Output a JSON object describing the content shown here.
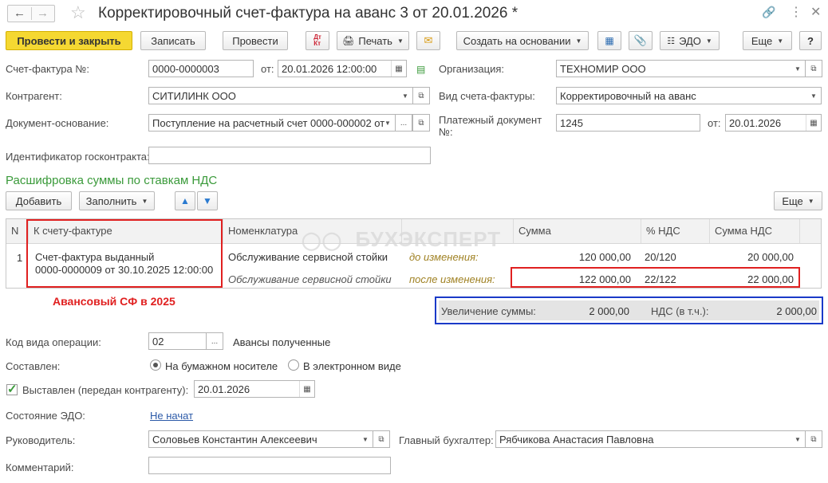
{
  "window": {
    "title": "Корректировочный счет-фактура на аванс 3 от 20.01.2026 *"
  },
  "toolbar": {
    "post_close": "Провести и закрыть",
    "save": "Записать",
    "post": "Провести",
    "dtkt_top": "Дт",
    "dtkt_bottom": "Кт",
    "print": "Печать",
    "create_based": "Создать на основании",
    "edo": "ЭДО",
    "more": "Еще",
    "help": "?"
  },
  "form": {
    "invoice_no_label": "Счет-фактура №:",
    "invoice_no": "0000-0000003",
    "from_label": "от:",
    "date": "20.01.2026 12:00:00",
    "org_label": "Организация:",
    "org": "ТЕХНОМИР ООО",
    "counterparty_label": "Контрагент:",
    "counterparty": "СИТИЛИНК ООО",
    "invoice_type_label": "Вид счета-фактуры:",
    "invoice_type": "Корректировочный на аванс",
    "basis_label": "Документ-основание:",
    "basis": "Поступление на расчетный счет 0000-000002 от",
    "payment_doc_label_1": "Платежный документ",
    "payment_doc_label_2": "№:",
    "payment_doc": "1245",
    "payment_from_label": "от:",
    "payment_date": "20.01.2026",
    "gov_contract_label": "Идентификатор госконтракта:",
    "gov_contract": ""
  },
  "section": {
    "title": "Расшифровка суммы по ставкам НДС",
    "add": "Добавить",
    "fill": "Заполнить",
    "more": "Еще"
  },
  "table": {
    "headers": [
      "N",
      "К счету-фактуре",
      "Номенклатура",
      "",
      "Сумма",
      "% НДС",
      "Сумма НДС"
    ],
    "row": {
      "n": "1",
      "invoice_line1": "Счет-фактура выданный",
      "invoice_line2": "0000-0000009 от 30.10.2025 12:00:00",
      "before": {
        "item": "Обслуживание сервисной стойки",
        "state": "до изменения:",
        "sum": "120 000,00",
        "rate": "20/120",
        "vat": "20 000,00"
      },
      "after": {
        "item": "Обслуживание сервисной стойки",
        "state": "после изменения:",
        "sum": "122 000,00",
        "rate": "22/122",
        "vat": "22 000,00"
      }
    }
  },
  "watermark": "БУХЭКСПЕРТ",
  "annotation": "Авансовый СФ в 2025",
  "totals": {
    "increase_label": "Увеличение суммы:",
    "increase": "2 000,00",
    "vat_label": "НДС (в т.ч.):",
    "vat": "2 000,00"
  },
  "bottom": {
    "op_code_label": "Код вида операции:",
    "op_code": "02",
    "op_desc": "Авансы полученные",
    "composed_label": "Составлен:",
    "paper": "На бумажном носителе",
    "electronic": "В электронном виде",
    "issued_label": "Выставлен (передан контрагенту):",
    "issued_date": "20.01.2026",
    "edo_state_label": "Состояние ЭДО:",
    "edo_state": "Не начат",
    "head_label": "Руководитель:",
    "head": "Соловьев Константин Алексеевич",
    "chief_acc_label": "Главный бухгалтер:",
    "chief_acc": "Рябчикова Анастасия Павловна",
    "comment_label": "Комментарий:",
    "comment": ""
  },
  "colors": {
    "primary_button": "#f5d832",
    "section_title": "#3a9a3a",
    "highlight_red": "#e02020",
    "highlight_blue": "#1a3ac8",
    "link": "#2c5aa8"
  }
}
